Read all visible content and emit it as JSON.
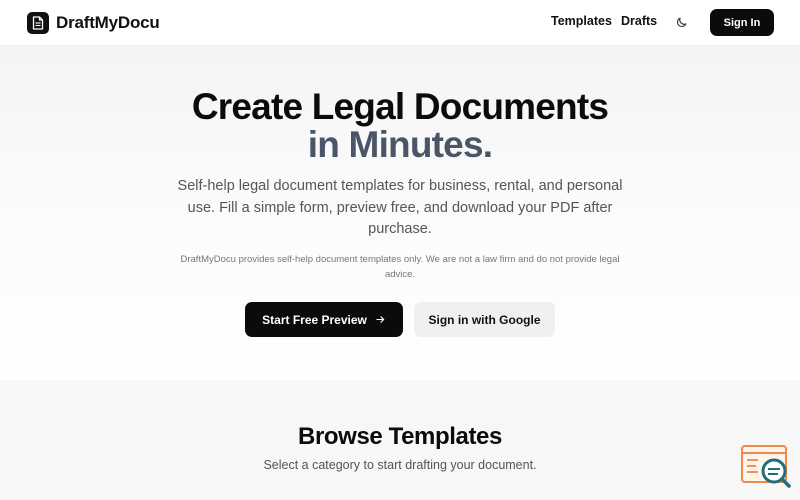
{
  "header": {
    "brand_name": "DraftMyDocu",
    "nav": {
      "templates": "Templates",
      "drafts": "Drafts"
    },
    "sign_in": "Sign In",
    "icons": [
      "document-icon",
      "moon-icon"
    ]
  },
  "hero": {
    "title_line1": "Create Legal Documents",
    "title_line2": "in Minutes.",
    "subtitle": "Self-help legal document templates for business, rental, and personal use. Fill a simple form, preview free, and download your PDF after purchase.",
    "disclaimer": "DraftMyDocu provides self-help document templates only. We are not a law firm and do not provide legal advice.",
    "primary_cta": "Start Free Preview",
    "secondary_cta": "Sign in with Google"
  },
  "browse": {
    "title": "Browse Templates",
    "subtitle": "Select a category to start drafting your document."
  },
  "colors": {
    "primary": "#0b0b0b",
    "accent_title": "#4a5568",
    "widget_orange": "#f0884a",
    "widget_teal": "#1f6f78"
  }
}
